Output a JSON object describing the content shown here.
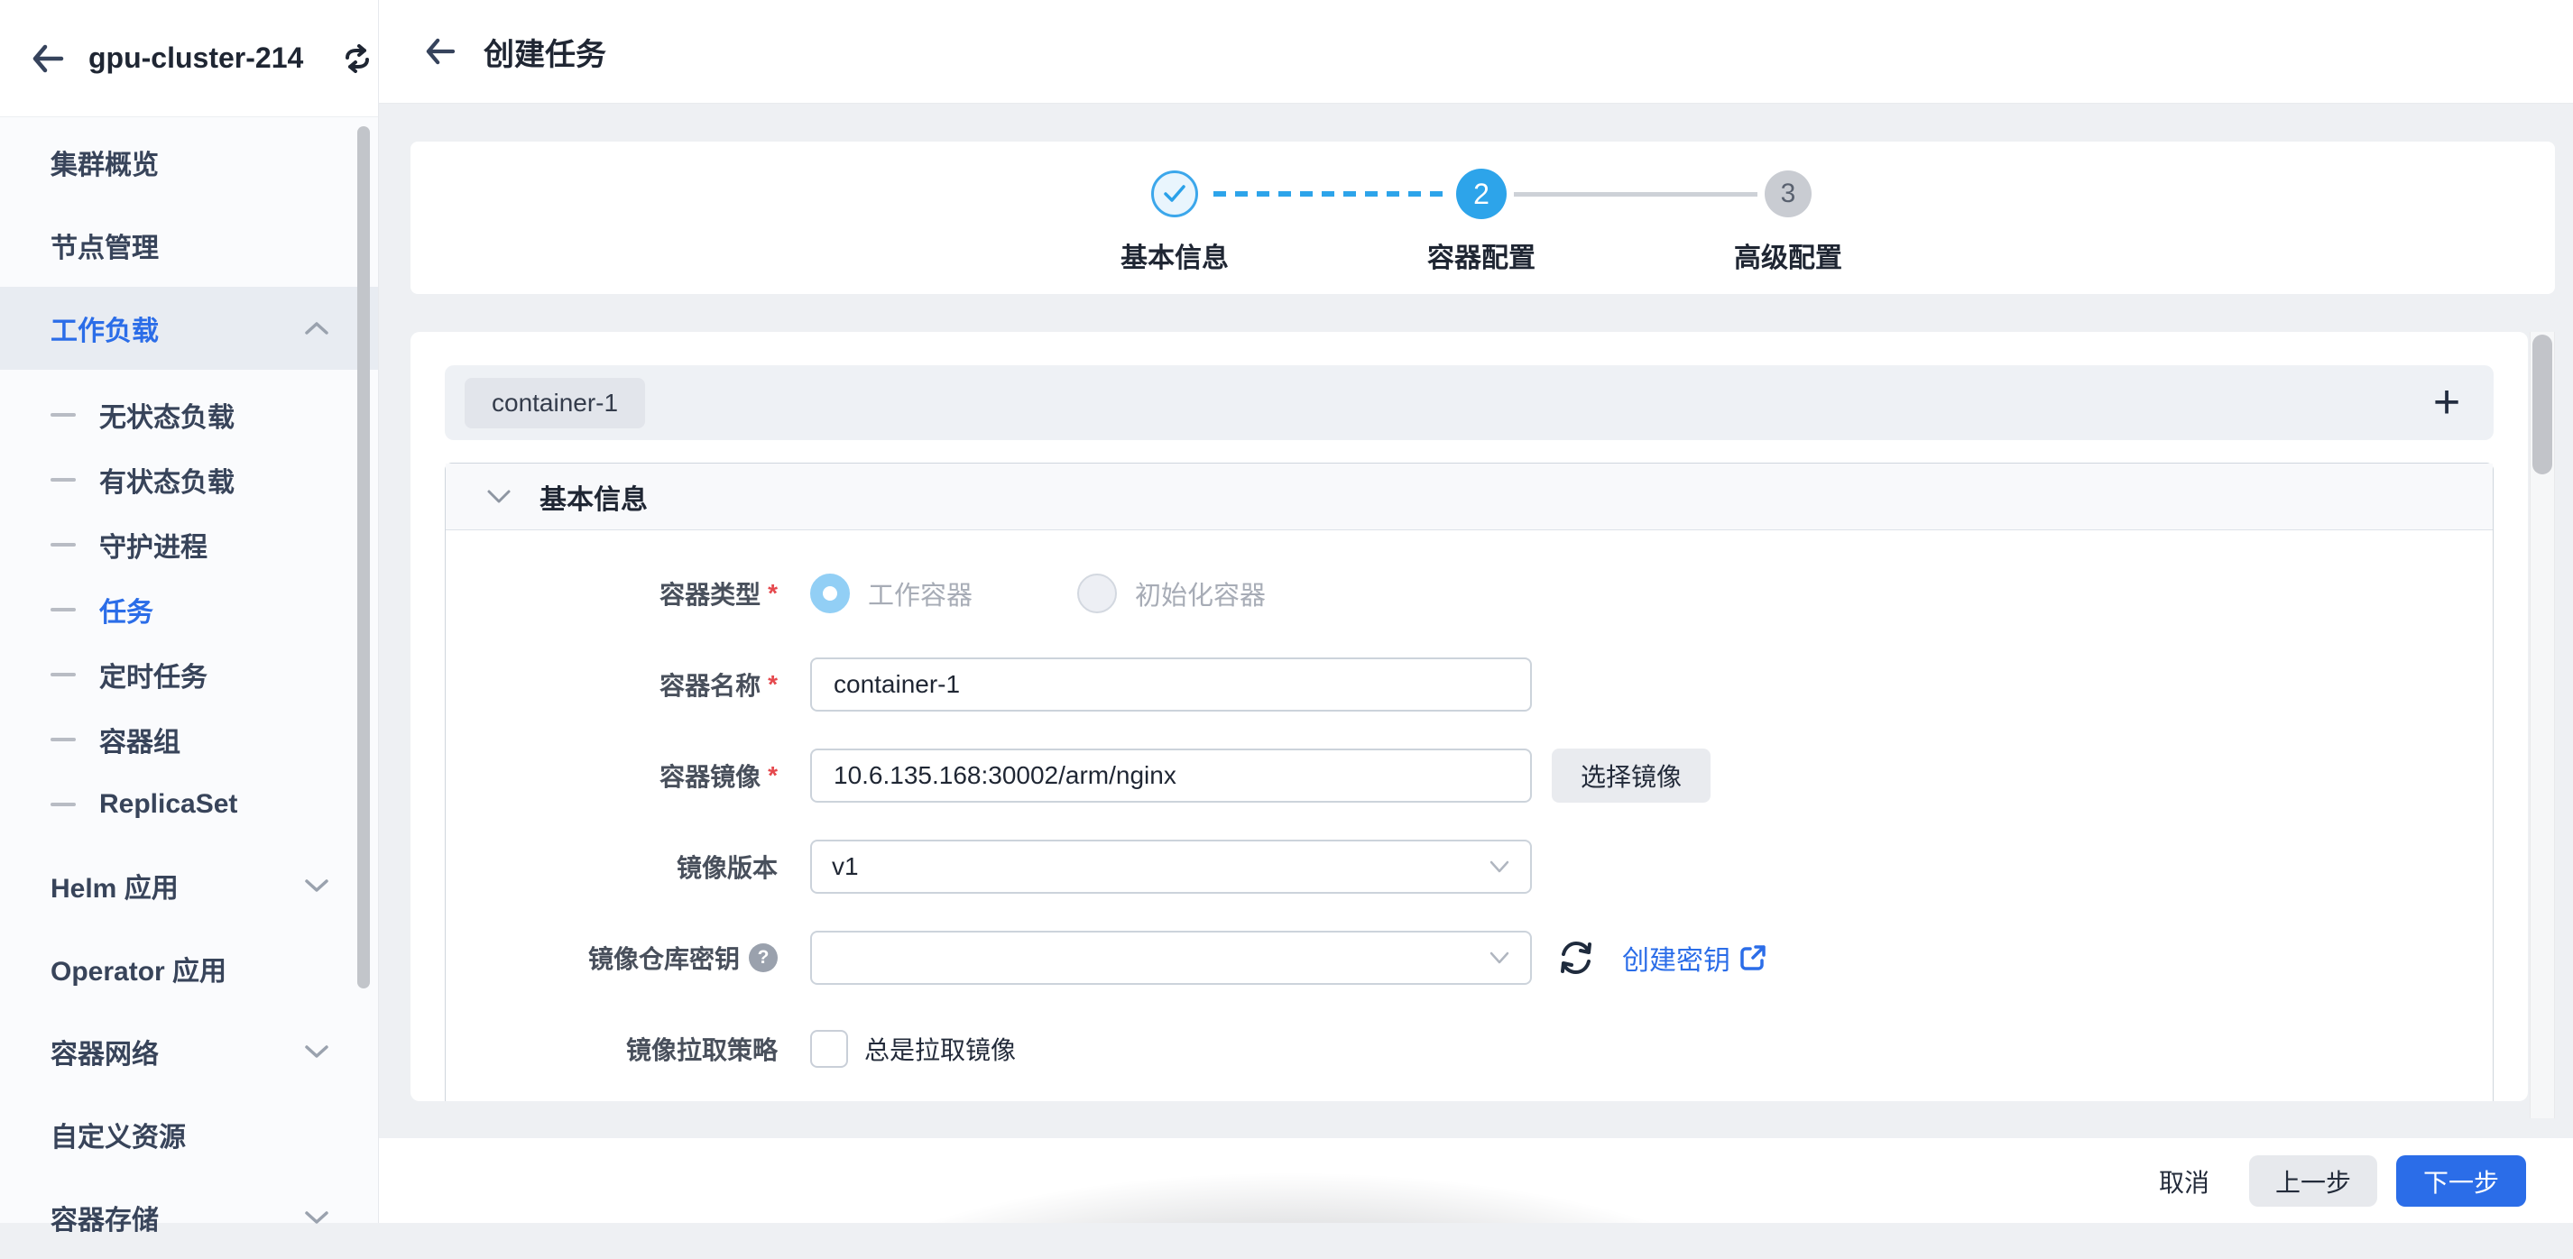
{
  "sidebar": {
    "cluster_name": "gpu-cluster-214",
    "items": [
      {
        "label": "集群概览"
      },
      {
        "label": "节点管理"
      },
      {
        "label": "工作负载"
      },
      {
        "label": "无状态负载"
      },
      {
        "label": "有状态负载"
      },
      {
        "label": "守护进程"
      },
      {
        "label": "任务"
      },
      {
        "label": "定时任务"
      },
      {
        "label": "容器组"
      },
      {
        "label": "ReplicaSet"
      },
      {
        "label": "Helm 应用"
      },
      {
        "label": "Operator 应用"
      },
      {
        "label": "容器网络"
      },
      {
        "label": "自定义资源"
      },
      {
        "label": "容器存储"
      }
    ]
  },
  "header": {
    "title": "创建任务"
  },
  "stepper": {
    "steps": [
      {
        "label": "基本信息",
        "state": "done"
      },
      {
        "label": "容器配置",
        "state": "active",
        "number": "2"
      },
      {
        "label": "高级配置",
        "state": "pending",
        "number": "3"
      }
    ]
  },
  "container_tabs": {
    "active_tab": "container-1",
    "add_label": "+"
  },
  "form": {
    "required_marker": "*",
    "section_title": "基本信息",
    "rows": {
      "container_type": {
        "label": "容器类型",
        "required": true,
        "option_work": "工作容器",
        "option_init": "初始化容器",
        "selected": "工作容器"
      },
      "container_name": {
        "label": "容器名称",
        "required": true,
        "value": "container-1"
      },
      "container_image": {
        "label": "容器镜像",
        "required": true,
        "value": "10.6.135.168:30002/arm/nginx",
        "button": "选择镜像"
      },
      "image_version": {
        "label": "镜像版本",
        "value": "v1"
      },
      "registry_secret": {
        "label": "镜像仓库密钥",
        "help_icon": "?",
        "value": "",
        "link": "创建密钥"
      },
      "pull_policy": {
        "label": "镜像拉取策略",
        "checkbox_label": "总是拉取镜像",
        "checked": false
      }
    }
  },
  "footer": {
    "cancel": "取消",
    "prev": "上一步",
    "next": "下一步"
  },
  "colors": {
    "accent_blue": "#2b6de8",
    "step_blue": "#2da4ea",
    "pending_gray": "#c9ccd2",
    "required_red": "#e5484d",
    "content_bg": "#eef0f3"
  }
}
